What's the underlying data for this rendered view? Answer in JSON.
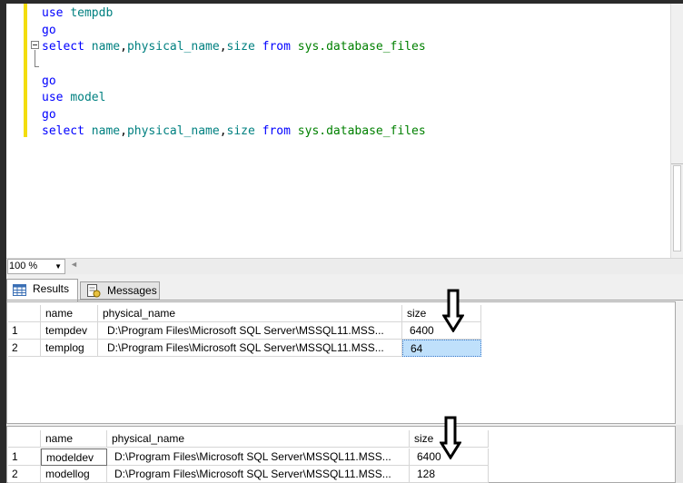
{
  "editor": {
    "lines": [
      [
        {
          "t": "use ",
          "c": "kw"
        },
        {
          "t": "tempdb",
          "c": "id"
        }
      ],
      [
        {
          "t": "go",
          "c": "kw"
        }
      ],
      [
        {
          "t": "select ",
          "c": "kw"
        },
        {
          "t": "name",
          "c": "id"
        },
        {
          "t": ",",
          "c": "plain"
        },
        {
          "t": "physical_name",
          "c": "id"
        },
        {
          "t": ",",
          "c": "plain"
        },
        {
          "t": "size ",
          "c": "id"
        },
        {
          "t": "from ",
          "c": "kw"
        },
        {
          "t": "sys.database_files",
          "c": "sys"
        }
      ],
      [],
      [
        {
          "t": "go",
          "c": "kw"
        }
      ],
      [
        {
          "t": "use ",
          "c": "kw"
        },
        {
          "t": "model",
          "c": "id"
        }
      ],
      [
        {
          "t": "go",
          "c": "kw"
        }
      ],
      [
        {
          "t": "select ",
          "c": "kw"
        },
        {
          "t": "name",
          "c": "id"
        },
        {
          "t": ",",
          "c": "plain"
        },
        {
          "t": "physical_name",
          "c": "id"
        },
        {
          "t": ",",
          "c": "plain"
        },
        {
          "t": "size ",
          "c": "id"
        },
        {
          "t": "from ",
          "c": "kw"
        },
        {
          "t": "sys.database_files",
          "c": "sys"
        }
      ]
    ]
  },
  "zoom": {
    "value": "100 %"
  },
  "tabs": {
    "results_label": "Results",
    "messages_label": "Messages"
  },
  "grid1": {
    "headers": [
      "name",
      "physical_name",
      "size"
    ],
    "rows": [
      {
        "num": "1",
        "name": "tempdev",
        "physical_name": "D:\\Program Files\\Microsoft SQL Server\\MSSQL11.MSS...",
        "size": "6400"
      },
      {
        "num": "2",
        "name": "templog",
        "physical_name": "D:\\Program Files\\Microsoft SQL Server\\MSSQL11.MSS...",
        "size": "64"
      }
    ]
  },
  "grid2": {
    "headers": [
      "name",
      "physical_name",
      "size"
    ],
    "rows": [
      {
        "num": "1",
        "name": "modeldev",
        "physical_name": "D:\\Program Files\\Microsoft SQL Server\\MSSQL11.MSS...",
        "size": "6400"
      },
      {
        "num": "2",
        "name": "modellog",
        "physical_name": "D:\\Program Files\\Microsoft SQL Server\\MSSQL11.MSS...",
        "size": "128"
      }
    ]
  },
  "icons": {
    "results_tab_icon": "grid-icon",
    "messages_tab_icon": "messages-icon",
    "annotation_arrow": "arrow-down-icon"
  }
}
